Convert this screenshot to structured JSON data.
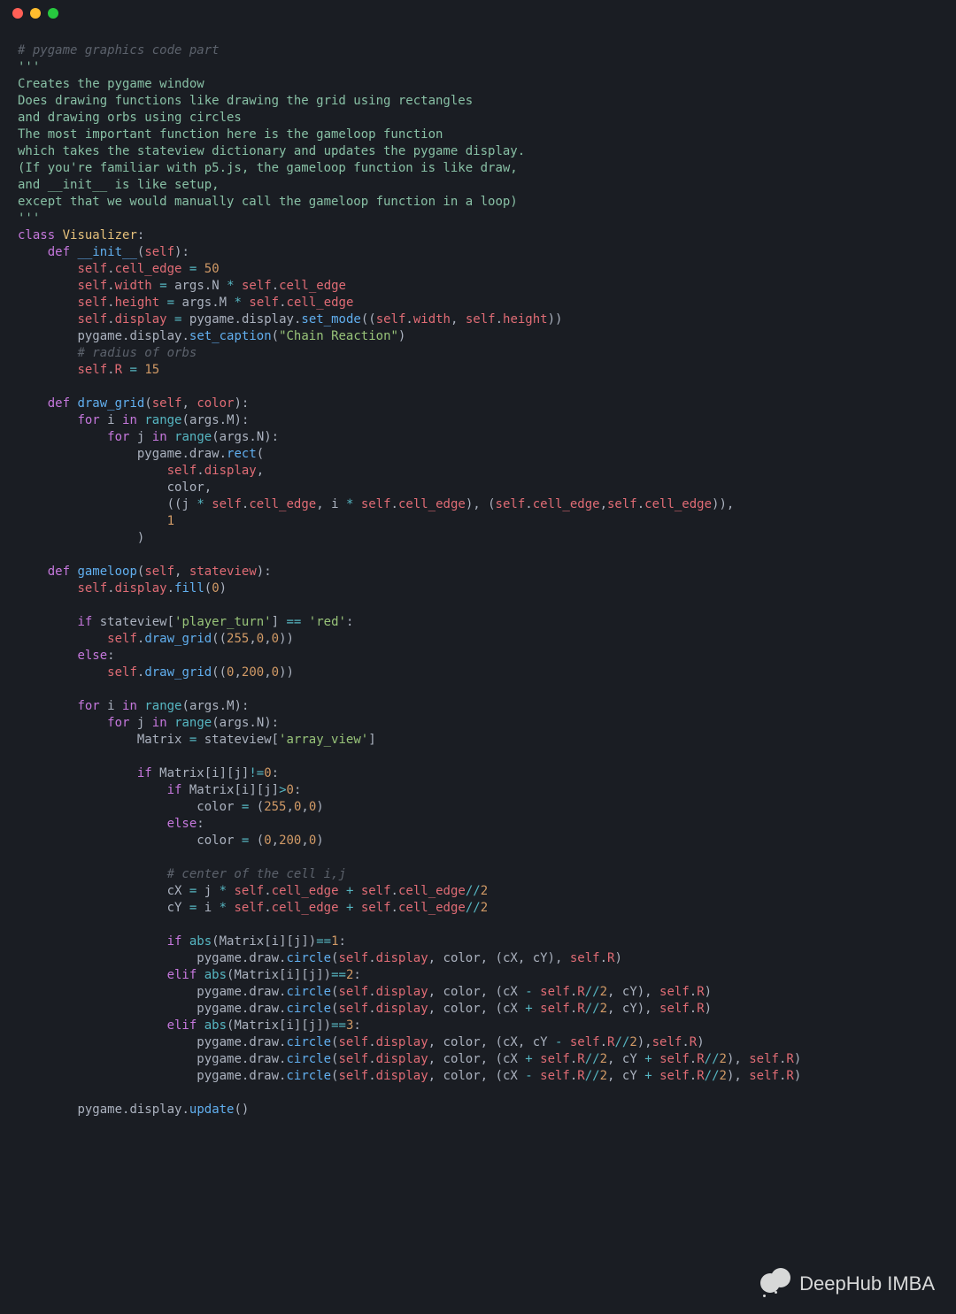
{
  "window": {
    "controls": [
      "close",
      "minimize",
      "zoom"
    ]
  },
  "watermark": {
    "text": "DeepHub IMBA"
  },
  "code": {
    "line_comment": "# pygame graphics code part",
    "docstring_open": "'''",
    "doc1": "Creates the pygame window",
    "doc2": "Does drawing functions like drawing the grid using rectangles",
    "doc3": "and drawing orbs using circles",
    "doc4": "The most important function here is the gameloop function",
    "doc5": "which takes the stateview dictionary and updates the pygame display.",
    "doc6": "(If you're familiar with p5.js, the gameloop function is like draw,",
    "doc7": "and __init__ is like setup,",
    "doc8": "except that we would manually call the gameloop function in a loop)",
    "docstring_close": "'''",
    "kw_class": "class",
    "cls_name": "Visualizer",
    "kw_def": "def",
    "fn_init": "__init__",
    "fn_drawgrid": "draw_grid",
    "fn_gameloop": "gameloop",
    "p_self": "self",
    "p_color": "color",
    "p_sv": "stateview",
    "attr_cell_edge": "cell_edge",
    "attr_width": "width",
    "attr_height": "height",
    "attr_display": "display",
    "attr_R": "R",
    "id_args": "args",
    "id_N": "N",
    "id_M": "M",
    "id_pygame": "pygame",
    "id_draw": "draw",
    "id_rect": "rect",
    "id_circle": "circle",
    "id_display_mod": "display",
    "id_set_mode": "set_mode",
    "id_set_caption": "set_caption",
    "id_fill": "fill",
    "id_update": "update",
    "id_Matrix": "Matrix",
    "id_cX": "cX",
    "id_cY": "cY",
    "id_i": "i",
    "id_j": "j",
    "id_range": "range",
    "id_abs": "abs",
    "kw_for": "for",
    "kw_in": "in",
    "kw_if": "if",
    "kw_elif": "elif",
    "kw_else": "else",
    "n50": "50",
    "n15": "15",
    "n0": "0",
    "n1": "1",
    "n2": "2",
    "n3": "3",
    "n200": "200",
    "n255": "255",
    "s_caption": "\"Chain Reaction\"",
    "s_player_turn": "'player_turn'",
    "s_red": "'red'",
    "s_array_view": "'array_view'",
    "cmt_radius": "# radius of orbs",
    "cmt_center": "# center of the cell i,j"
  }
}
